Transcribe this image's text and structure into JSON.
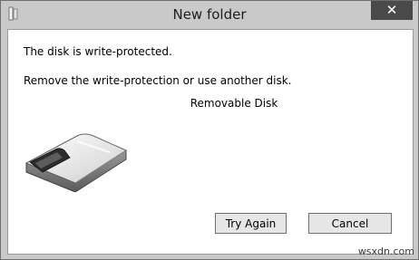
{
  "window": {
    "title": "New folder",
    "close_label": "✕"
  },
  "message": {
    "line1": "The disk is write-protected.",
    "line2": "Remove the write-protection or use another disk.",
    "device_name": "Removable Disk"
  },
  "buttons": {
    "try_again": "Try Again",
    "cancel": "Cancel"
  },
  "watermark": "wsxdn.com",
  "icons": {
    "app": "folder-icon",
    "device": "removable-disk-icon"
  }
}
